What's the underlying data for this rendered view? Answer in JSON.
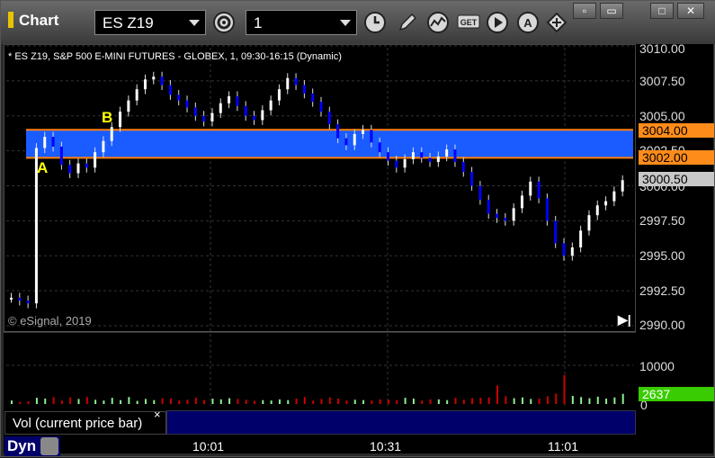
{
  "toolbar": {
    "app_title": "Chart",
    "symbol": "ES Z19",
    "interval": "1",
    "icons": [
      "gear-icon",
      "clock-icon",
      "pencil-icon",
      "studies-icon",
      "get-icon",
      "play-icon",
      "auto-icon",
      "cursor-icon"
    ],
    "get_label": "GET",
    "auto_label": "A"
  },
  "window_controls": [
    "restore-icon",
    "tile-icon",
    "maximize-icon",
    "close-icon"
  ],
  "chart": {
    "header": "* ES Z19, S&P 500 E-MINI FUTURES - GLOBEX, 1, 09:30-16:15 (Dynamic)",
    "copyright": "© eSignal, 2019",
    "marker_a": "A",
    "marker_b": "B",
    "price_labels": [
      "3010.00",
      "3007.50",
      "3005.00",
      "3002.50",
      "3000.00",
      "2997.50",
      "2995.00",
      "2992.50",
      "2990.00"
    ],
    "level_high": "3004.00",
    "level_low": "3002.00",
    "last_price": "3000.50",
    "vol_axis_label": "10000",
    "vol_zero": "0",
    "last_volume": "2637",
    "time_labels": [
      "10:01",
      "10:31",
      "11:01"
    ],
    "vol_study_label": "Vol (current price bar)",
    "vol_close": "×",
    "dyn_label": "Dyn",
    "go_end": "▶|"
  },
  "colors": {
    "band_fill": "#1a5cff",
    "band_edge": "#ff8000",
    "up_bar": "#ffffff",
    "down_bar": "#0000ff",
    "vol_up": "#90ee90",
    "vol_down": "#cc0000",
    "last_volume_bg": "#39cc00"
  },
  "chart_data": {
    "type": "candlestick",
    "ylim": [
      2990,
      3010
    ],
    "levels": [
      3004.0,
      3002.0
    ],
    "prices": [
      2992,
      2991.8,
      2991.6,
      3002.7,
      3003.5,
      3002.8,
      3001.5,
      3000.9,
      3001.6,
      3001.3,
      3002.4,
      3003.2,
      3004.2,
      3005.3,
      3006.1,
      3006.9,
      3007.6,
      3007.8,
      3007.2,
      3006.5,
      3006.1,
      3005.6,
      3005.0,
      3004.6,
      3005.2,
      3005.9,
      3006.4,
      3005.7,
      3005.0,
      3004.7,
      3005.4,
      3006.1,
      3006.9,
      3007.7,
      3007.2,
      3006.6,
      3006.0,
      3005.3,
      3004.4,
      3003.4,
      3002.9,
      3003.7,
      3004.0,
      3003.1,
      3002.4,
      3001.8,
      3001.3,
      3001.9,
      3002.4,
      3002.0,
      3001.7,
      3002.1,
      3002.6,
      3001.7,
      3001.0,
      3000.0,
      2999.0,
      2998.0,
      2997.7,
      2997.5,
      2998.4,
      2999.3,
      3000.3,
      2999.1,
      2997.5,
      2995.9,
      2995.0,
      2995.6,
      2996.8,
      2997.9,
      2998.6,
      2998.9,
      2999.6,
      3000.4
    ],
    "volume": [
      900,
      600,
      700,
      1600,
      1400,
      1800,
      900,
      1700,
      1300,
      1800,
      1100,
      900,
      1600,
      1000,
      1800,
      800,
      1300,
      1000,
      1500,
      1400,
      900,
      1100,
      1600,
      1000,
      1400,
      1200,
      1500,
      1300,
      1100,
      800,
      1000,
      900,
      1200,
      1000,
      1400,
      1800,
      900,
      1300,
      1700,
      1400,
      900,
      1100,
      1000,
      900,
      1200,
      1100,
      1000,
      1600,
      1400,
      900,
      1200,
      1200,
      1000,
      1600,
      1100,
      1500,
      1600,
      1700,
      4800,
      2000,
      1500,
      1700,
      1300,
      1400,
      2000,
      2700,
      7500,
      2100,
      1800,
      1500,
      1900,
      1400,
      1700,
      2637
    ]
  }
}
